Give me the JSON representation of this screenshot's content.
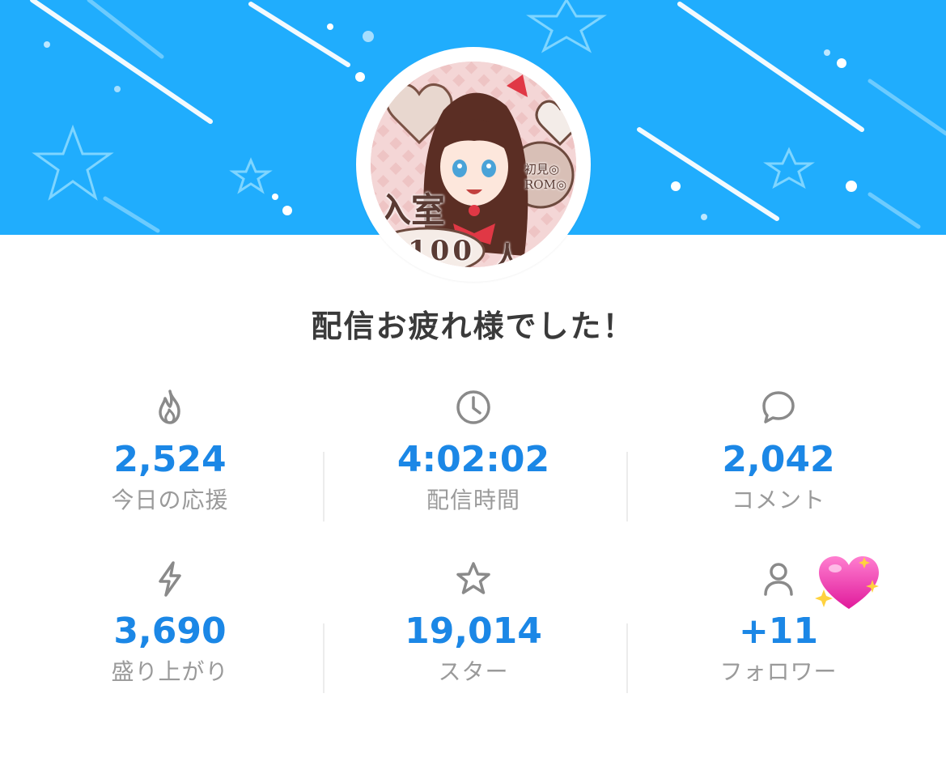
{
  "header": {
    "title": "配信お疲れ様でした！"
  },
  "avatar": {
    "overlay_text_1": "入室",
    "overlay_text_2": "100",
    "overlay_text_3": "人",
    "badge_line_1": "初見◎",
    "badge_line_2": "ROM◎"
  },
  "stats": [
    {
      "icon": "flame-icon",
      "value": "2,524",
      "label": "今日の応援"
    },
    {
      "icon": "clock-icon",
      "value": "4:02:02",
      "label": "配信時間"
    },
    {
      "icon": "comment-icon",
      "value": "2,042",
      "label": "コメント"
    },
    {
      "icon": "lightning-icon",
      "value": "3,690",
      "label": "盛り上がり"
    },
    {
      "icon": "star-icon",
      "value": "19,014",
      "label": "スター"
    },
    {
      "icon": "person-icon",
      "value": "+11",
      "label": "フォロワー"
    }
  ],
  "colors": {
    "banner": "#20adfd",
    "accent_value": "#1b87e6",
    "label": "#9a9a9a",
    "icon": "#8a8a8a"
  }
}
